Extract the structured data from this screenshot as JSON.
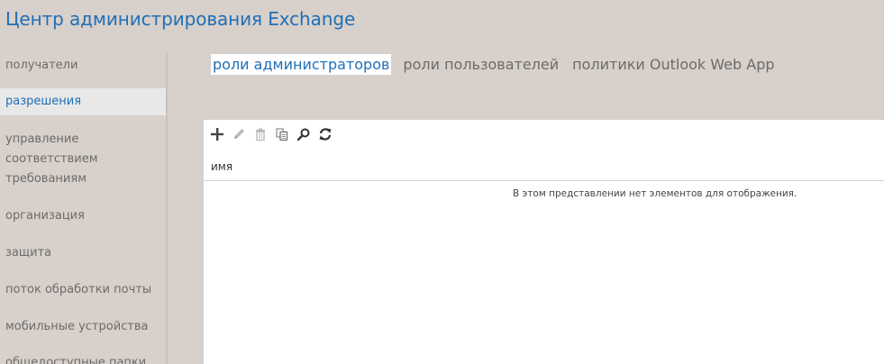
{
  "app": {
    "title": "Центр администрирования Exchange"
  },
  "sidebar": {
    "items": [
      {
        "label": "получатели"
      },
      {
        "label": "разрешения"
      },
      {
        "label": "управление соответствием требованиям"
      },
      {
        "label": "организация"
      },
      {
        "label": "защита"
      },
      {
        "label": "поток обработки почты"
      },
      {
        "label": "мобильные устройства"
      },
      {
        "label": "общедоступные папки"
      }
    ]
  },
  "tabs": [
    {
      "label": "роли администраторов"
    },
    {
      "label": "роли пользователей"
    },
    {
      "label": "политики Outlook Web App"
    }
  ],
  "toolbar": {
    "buttons": [
      {
        "icon": "add-icon"
      },
      {
        "icon": "edit-icon"
      },
      {
        "icon": "delete-icon"
      },
      {
        "icon": "copy-icon"
      },
      {
        "icon": "search-icon"
      },
      {
        "icon": "refresh-icon"
      }
    ]
  },
  "table": {
    "columns": [
      "имя"
    ],
    "empty_message": "В этом представлении нет элементов для отображения."
  },
  "colors": {
    "accent": "#1f6fb8",
    "background": "#d8d0ca",
    "selected_nav_bg": "#e8e8e8"
  }
}
